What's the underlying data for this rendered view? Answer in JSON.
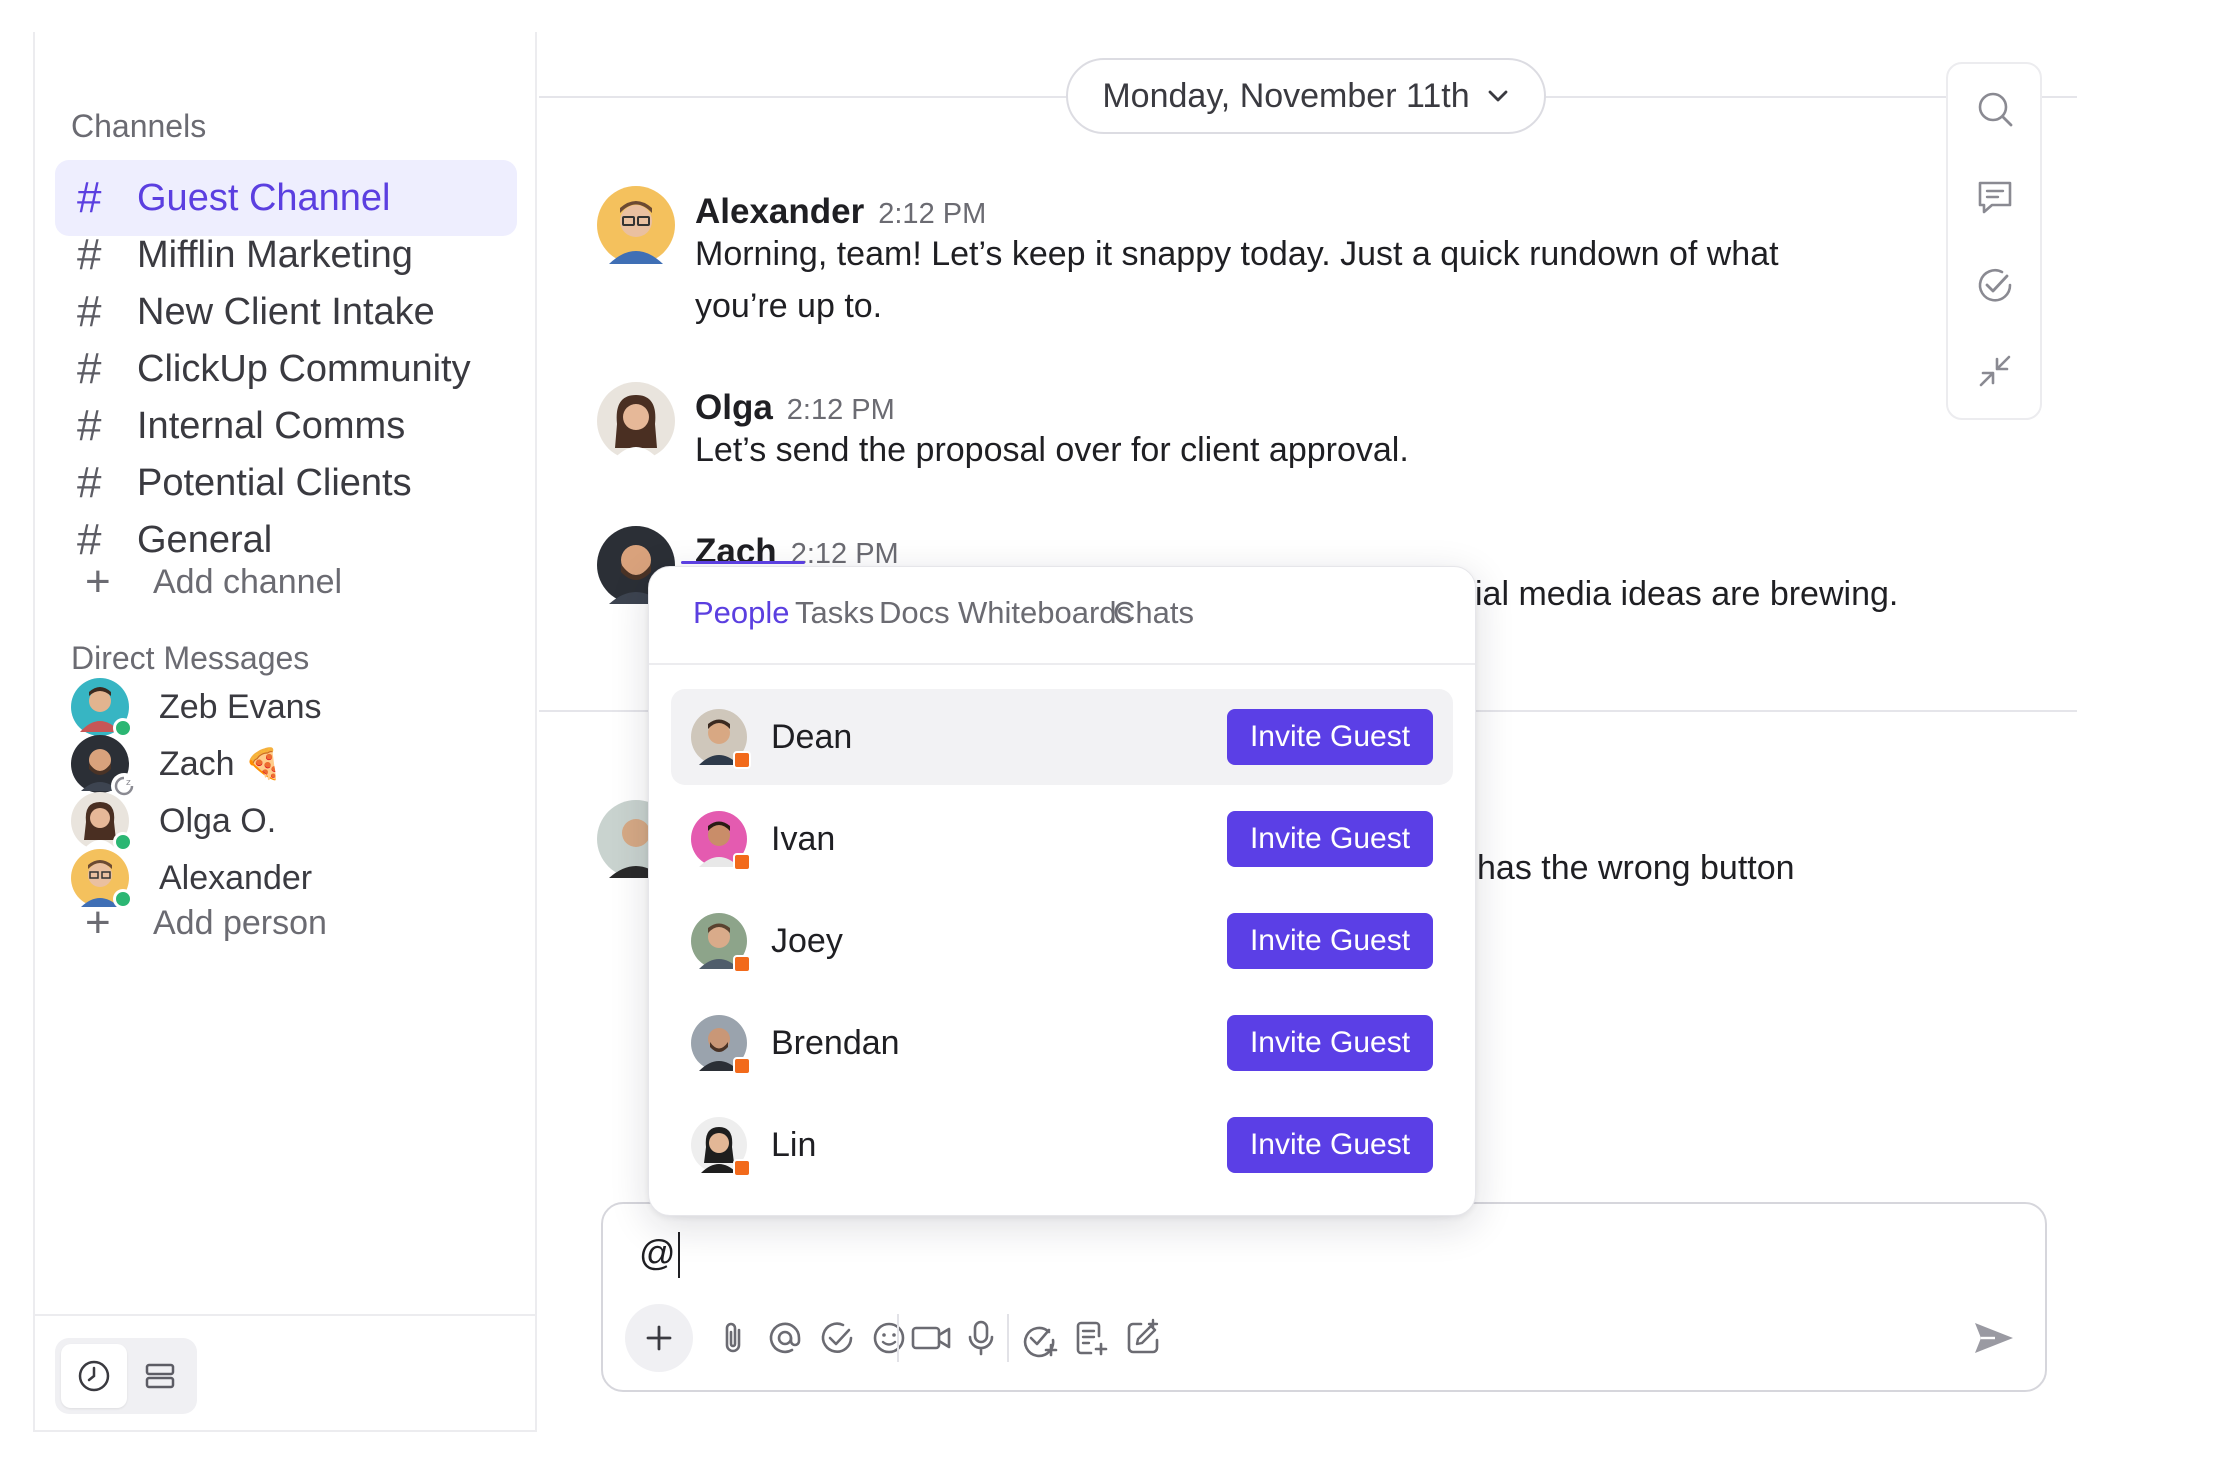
{
  "sidebar": {
    "channels_title": "Channels",
    "channels": [
      {
        "label": "Guest Channel",
        "active": true
      },
      {
        "label": "Mifflin Marketing"
      },
      {
        "label": "New Client Intake"
      },
      {
        "label": "ClickUp Community"
      },
      {
        "label": "Internal Comms"
      },
      {
        "label": "Potential Clients"
      },
      {
        "label": "General"
      }
    ],
    "add_channel": "Add channel",
    "dms_title": "Direct Messages",
    "dms": [
      {
        "name": "Zeb Evans",
        "status": "online"
      },
      {
        "name": "Zach",
        "emoji": "🍕",
        "status": "away"
      },
      {
        "name": "Olga O.",
        "status": "online"
      },
      {
        "name": "Alexander",
        "status": "online"
      }
    ],
    "add_person": "Add person"
  },
  "date_pill": "Monday, November 11th",
  "messages": [
    {
      "name": "Alexander",
      "time": "2:12 PM",
      "lines": [
        "Morning, team! Let’s keep it snappy today. Just a quick rundown of what",
        "you’re up to."
      ]
    },
    {
      "name": "Olga",
      "time": "2:12 PM",
      "lines": [
        "Let’s send the proposal over for client approval."
      ]
    },
    {
      "name": "Zach",
      "time": "2:12 PM",
      "lines": [
        "ial media ideas are brewing."
      ]
    },
    {
      "name": "",
      "time": "",
      "lines": [
        "has the wrong button"
      ]
    }
  ],
  "mention_popup": {
    "tabs": [
      "People",
      "Tasks",
      "Docs",
      "Whiteboards",
      "Chats"
    ],
    "active_tab": "People",
    "people": [
      {
        "name": "Dean",
        "action": "Invite Guest"
      },
      {
        "name": "Ivan",
        "action": "Invite Guest"
      },
      {
        "name": "Joey",
        "action": "Invite Guest"
      },
      {
        "name": "Brendan",
        "action": "Invite Guest"
      },
      {
        "name": "Lin",
        "action": "Invite Guest"
      }
    ]
  },
  "composer": {
    "value": "@"
  },
  "colors": {
    "accent": "#5b3fe6",
    "active_bg": "#eeeefe",
    "guest_badge": "#f26a1b",
    "online": "#2bb673"
  }
}
